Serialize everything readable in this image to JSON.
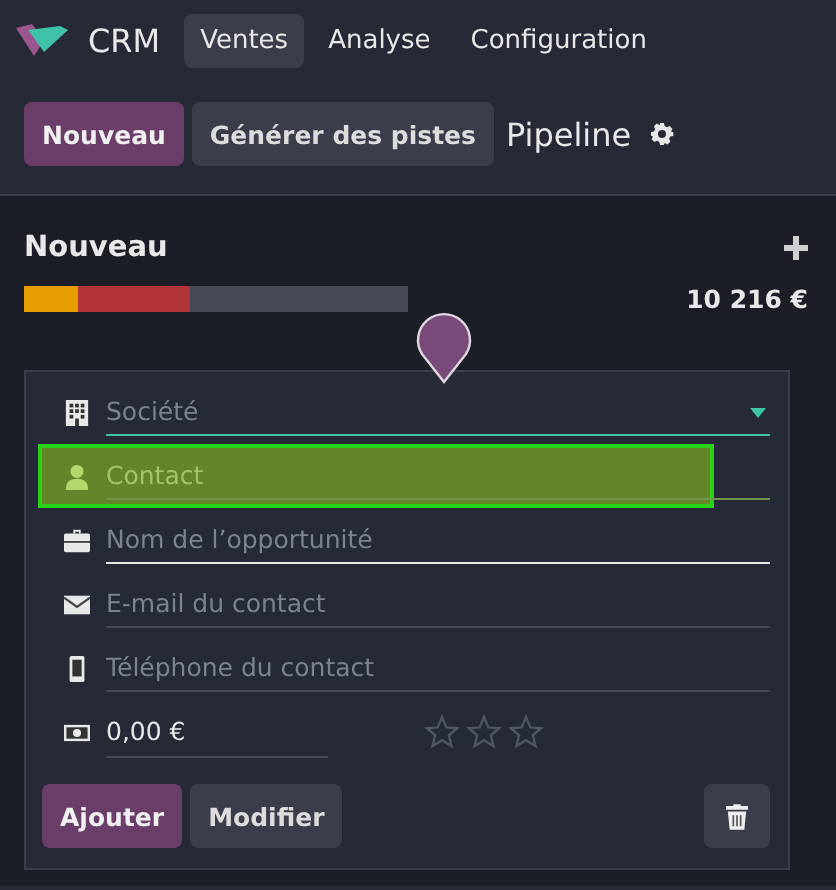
{
  "navbar": {
    "app_name": "CRM",
    "menu": [
      {
        "label": "Ventes",
        "selected": true
      },
      {
        "label": "Analyse",
        "selected": false
      },
      {
        "label": "Configuration",
        "selected": false
      }
    ]
  },
  "control_panel": {
    "buttons": [
      {
        "label": "Nouveau",
        "kind": "primary"
      },
      {
        "label": "Générer des pistes",
        "kind": "secondary"
      }
    ],
    "title": "Pipeline"
  },
  "column": {
    "title": "Nouveau",
    "progress": [
      {
        "color": "#e59d00",
        "level": 0.14
      },
      {
        "color": "#b13436",
        "level": 0.29
      }
    ],
    "total": "10 216 €"
  },
  "quick_create": {
    "fields": [
      {
        "kind": "company",
        "placeholder": "Société",
        "dropdown": true,
        "focused": true,
        "highlighted": false
      },
      {
        "kind": "contact",
        "placeholder": "Contact",
        "dropdown": false,
        "focused": false,
        "highlighted": true
      },
      {
        "kind": "opportunity",
        "placeholder": "Nom de l’opportunité",
        "dropdown": false,
        "focused": false,
        "highlighted": false,
        "required": true
      },
      {
        "kind": "email",
        "placeholder": "E-mail du contact",
        "dropdown": false,
        "focused": false,
        "highlighted": false
      },
      {
        "kind": "phone",
        "placeholder": "Téléphone du contact",
        "dropdown": false,
        "focused": false,
        "highlighted": false
      }
    ],
    "revenue": "0,00 €",
    "stars": 0,
    "buttons": [
      {
        "label": "Ajouter",
        "kind": "primary"
      },
      {
        "label": "Modifier",
        "kind": "secondary"
      }
    ]
  }
}
